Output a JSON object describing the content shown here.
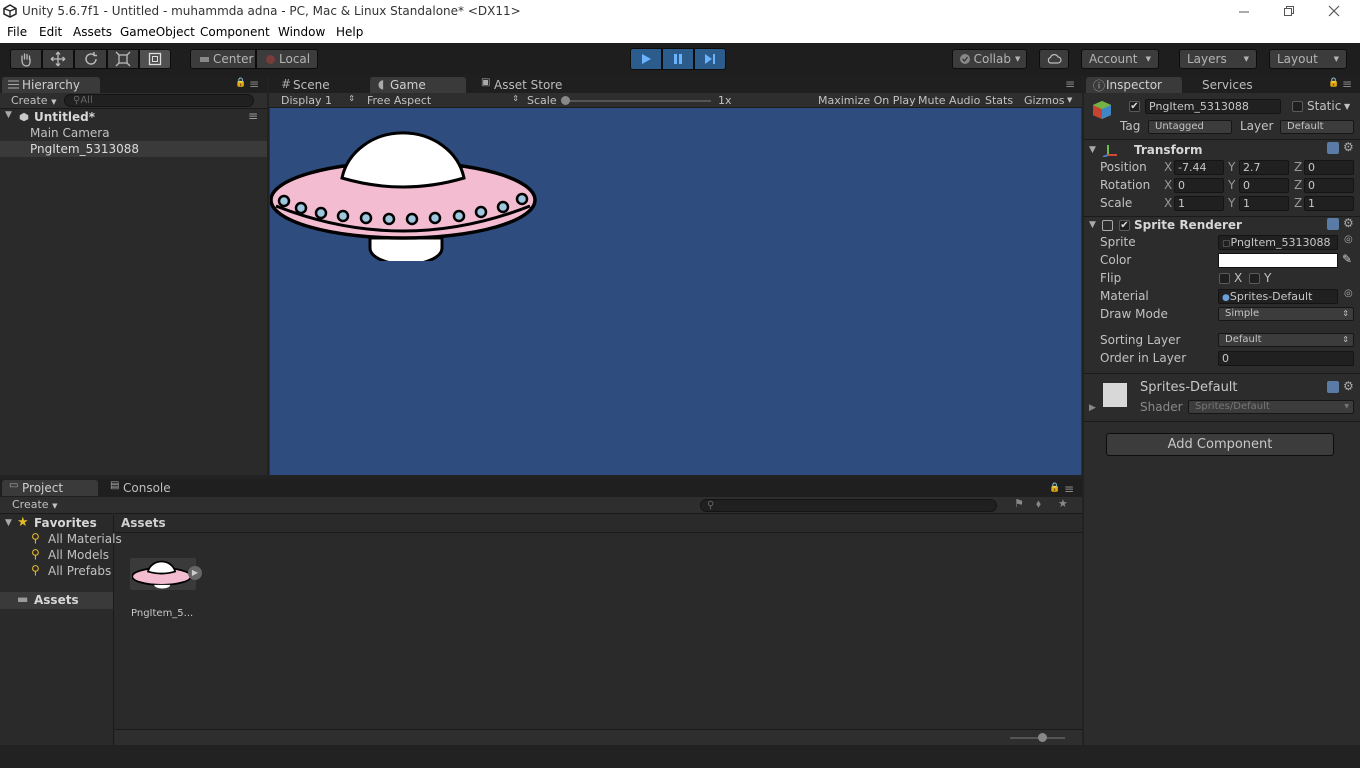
{
  "window": {
    "title": "Unity 5.6.7f1 - Untitled - muhammda adna - PC, Mac & Linux Standalone* <DX11>"
  },
  "menu": [
    "File",
    "Edit",
    "Assets",
    "GameObject",
    "Component",
    "Window",
    "Help"
  ],
  "toolbar": {
    "pivot": "Center",
    "space": "Local",
    "collab": "Collab",
    "account": "Account",
    "layers": "Layers",
    "layout": "Layout"
  },
  "hierarchy": {
    "tab": "Hierarchy",
    "create": "Create",
    "search_placeholder": "All",
    "scene": "Untitled*",
    "items": [
      "Main Camera",
      "PngItem_5313088"
    ]
  },
  "game": {
    "tabs": [
      "Scene",
      "Game",
      "Asset Store"
    ],
    "display": "Display 1",
    "aspect": "Free Aspect",
    "scale_label": "Scale",
    "scale_value": "1x",
    "options": [
      "Maximize On Play",
      "Mute Audio",
      "Stats",
      "Gizmos"
    ],
    "bg_color": "#2F4C7E"
  },
  "inspector": {
    "tabs": [
      "Inspector",
      "Services"
    ],
    "object": {
      "name": "PngItem_5313088",
      "static": "Static",
      "tag_label": "Tag",
      "tag": "Untagged",
      "layer_label": "Layer",
      "layer": "Default"
    },
    "transform": {
      "title": "Transform",
      "rows": [
        {
          "label": "Position",
          "x": "-7.44",
          "y": "2.7",
          "z": "0"
        },
        {
          "label": "Rotation",
          "x": "0",
          "y": "0",
          "z": "0"
        },
        {
          "label": "Scale",
          "x": "1",
          "y": "1",
          "z": "1"
        }
      ]
    },
    "sprite_renderer": {
      "title": "Sprite Renderer",
      "sprite_label": "Sprite",
      "sprite": "PngItem_5313088",
      "color_label": "Color",
      "flip_label": "Flip",
      "flip_x": "X",
      "flip_y": "Y",
      "material_label": "Material",
      "material": "Sprites-Default",
      "draw_mode_label": "Draw Mode",
      "draw_mode": "Simple",
      "sorting_layer_label": "Sorting Layer",
      "sorting_layer": "Default",
      "order_label": "Order in Layer",
      "order": "0"
    },
    "material": {
      "name": "Sprites-Default",
      "shader_label": "Shader",
      "shader": "Sprites/Default"
    },
    "add_component": "Add Component",
    "axis": {
      "x": "X",
      "y": "Y",
      "z": "Z"
    }
  },
  "project": {
    "tabs": [
      "Project",
      "Console"
    ],
    "create": "Create",
    "favorites": "Favorites",
    "fav_items": [
      "All Materials",
      "All Models",
      "All Prefabs"
    ],
    "assets_folder": "Assets",
    "breadcrumb": "Assets",
    "asset_item": "PngItem_5..."
  }
}
